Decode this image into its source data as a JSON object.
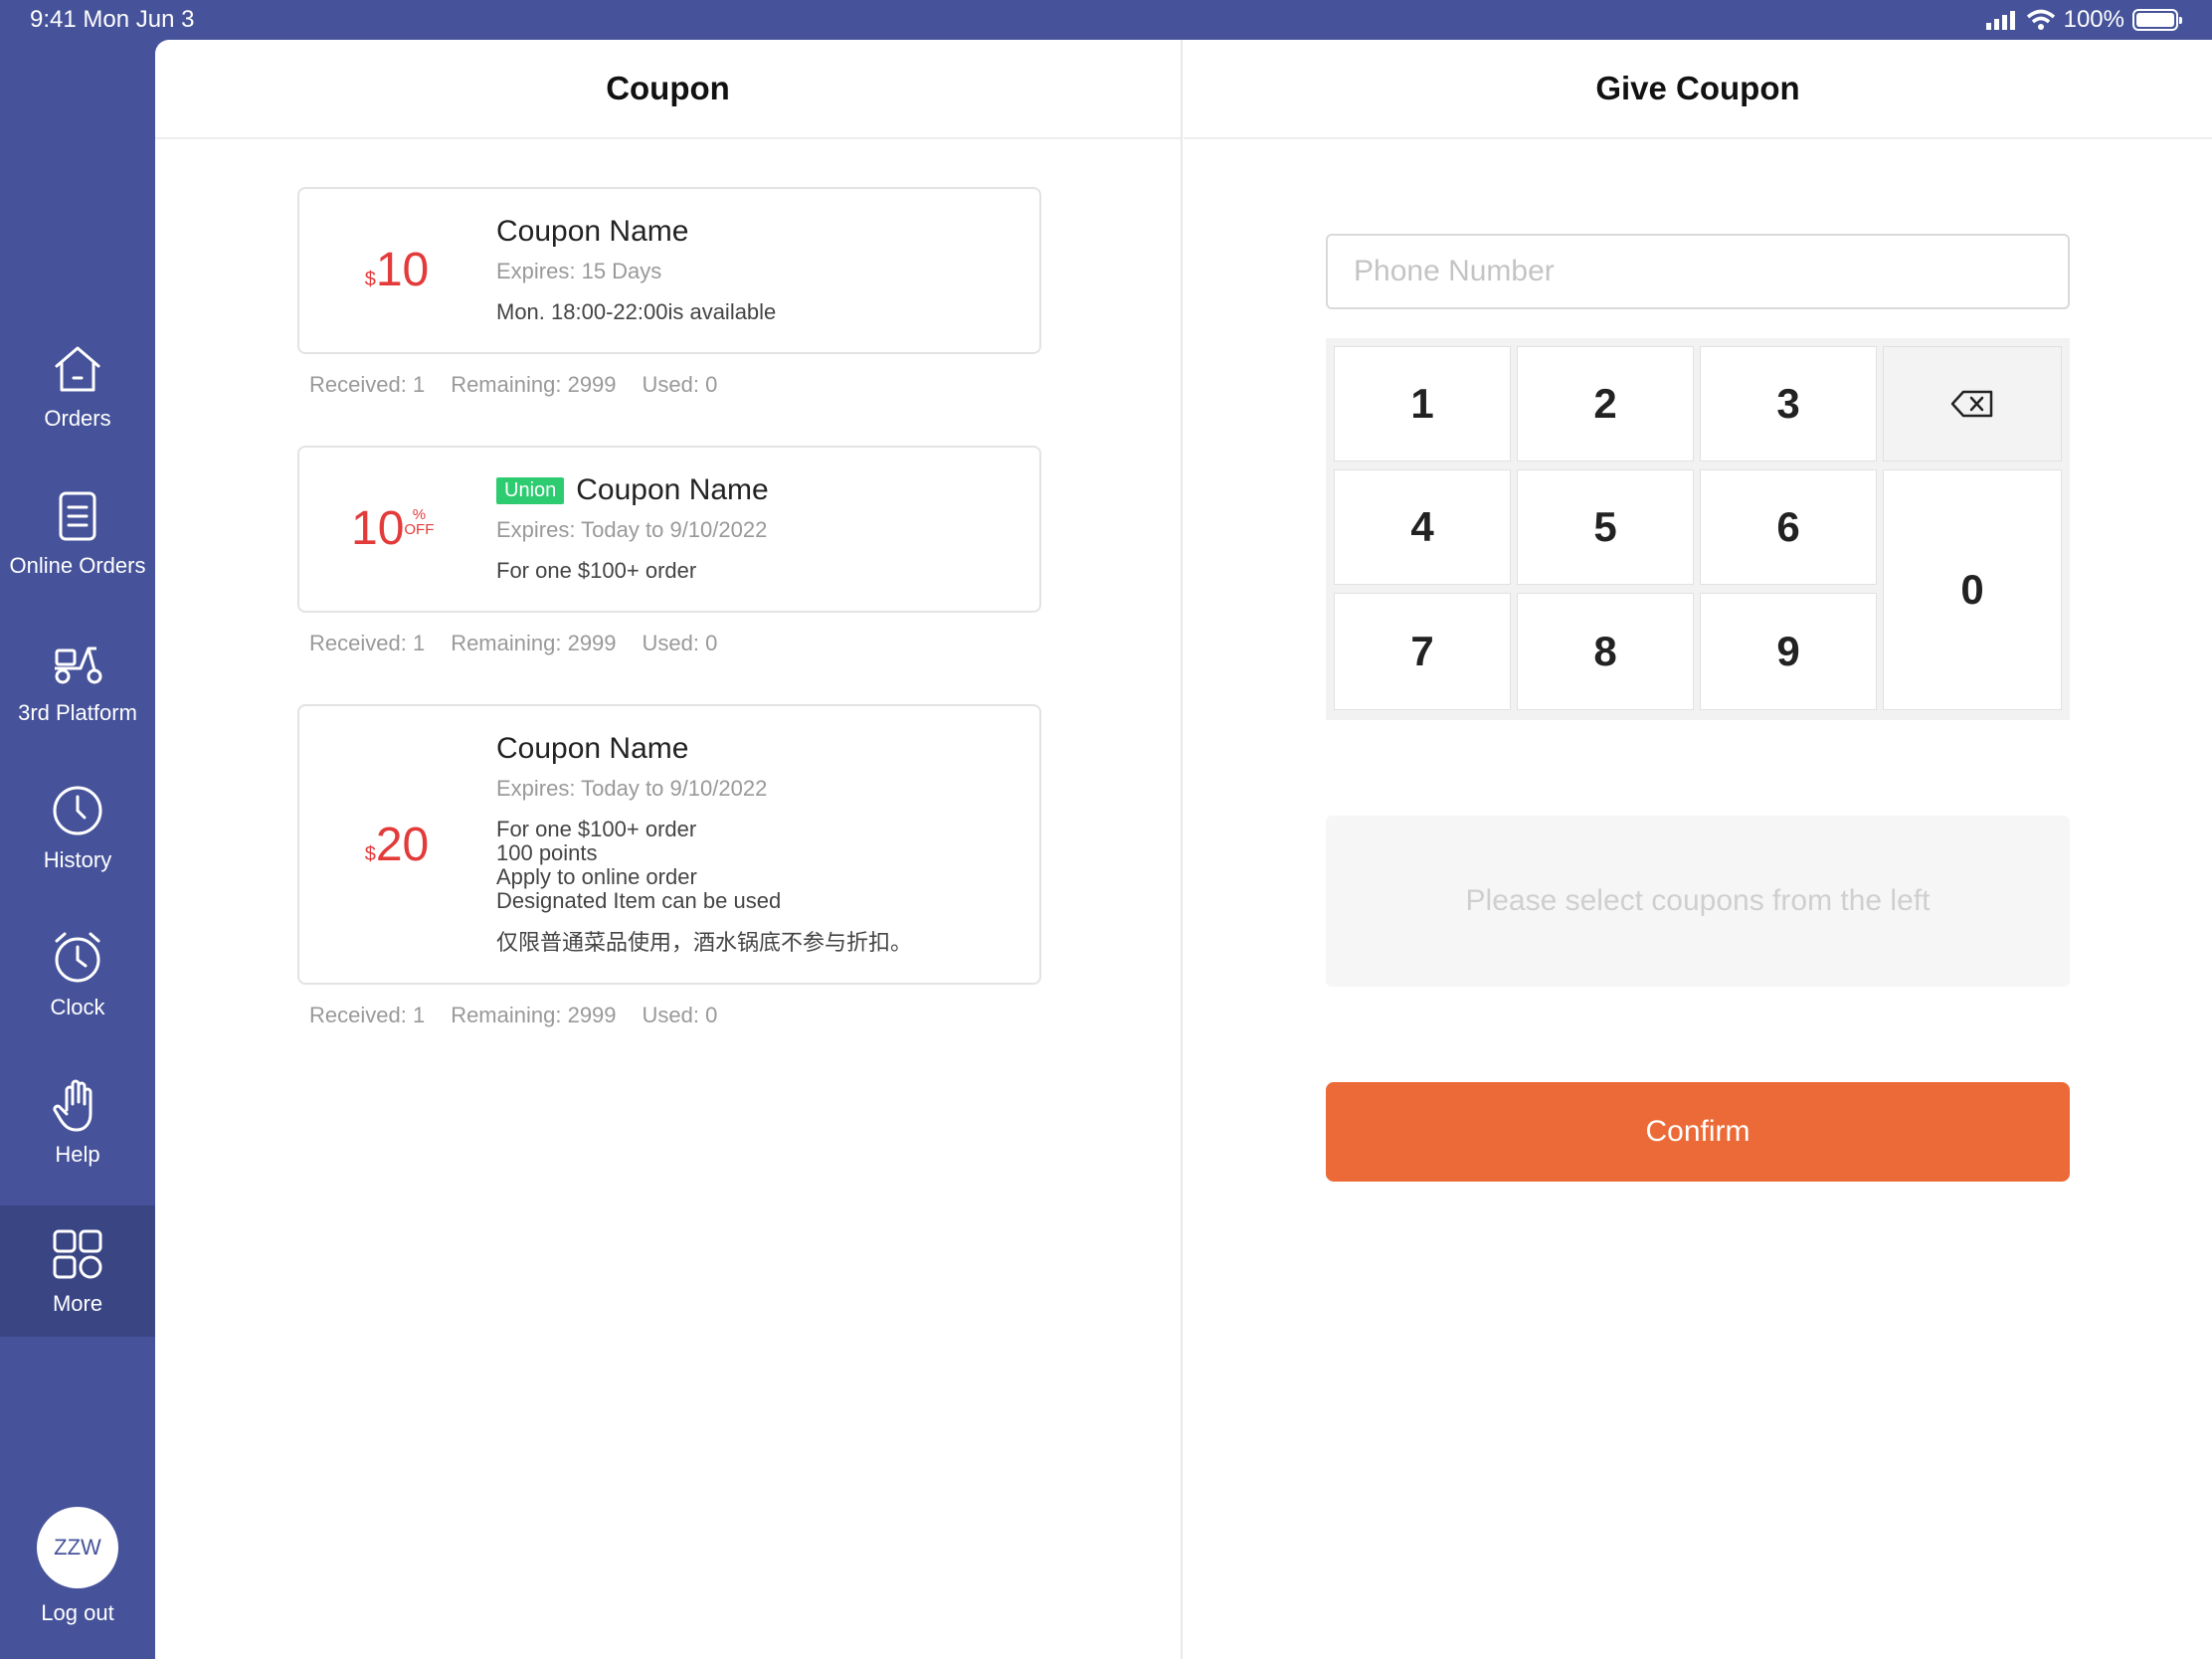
{
  "status_bar": {
    "time": "9:41  Mon Jun 3",
    "battery": "100%"
  },
  "sidebar": {
    "items": [
      {
        "label": "Orders",
        "icon": "home-icon"
      },
      {
        "label": "Online Orders",
        "icon": "document-icon"
      },
      {
        "label": "3rd Platform",
        "icon": "scooter-icon"
      },
      {
        "label": "History",
        "icon": "clock-icon"
      },
      {
        "label": "Clock",
        "icon": "alarm-clock-icon"
      },
      {
        "label": "Help",
        "icon": "hand-icon"
      },
      {
        "label": "More",
        "icon": "grid-icon",
        "active": true
      }
    ],
    "avatar": "ZZW",
    "logout": "Log out"
  },
  "left_panel": {
    "title": "Coupon",
    "coupons": [
      {
        "currency": "$",
        "amount": "10",
        "name": "Coupon Name",
        "expires": "Expires: 15 Days",
        "desc": [
          "Mon. 18:00-22:00is available"
        ],
        "received": "Received: 1",
        "remaining": "Remaining: 2999",
        "used": "Used: 0"
      },
      {
        "amount": "10",
        "pct": "%",
        "off": "OFF",
        "tag": "Union",
        "name": "Coupon Name",
        "expires": "Expires: Today to 9/10/2022",
        "desc": [
          "For one $100+ order"
        ],
        "received": "Received: 1",
        "remaining": "Remaining: 2999",
        "used": "Used: 0"
      },
      {
        "currency": "$",
        "amount": "20",
        "name": "Coupon Name",
        "expires": "Expires: Today to 9/10/2022",
        "desc": [
          "For one $100+ order",
          "100 points",
          "Apply to online order",
          "Designated Item can be used"
        ],
        "note": "仅限普通菜品使用，酒水锅底不参与折扣。",
        "received": "Received: 1",
        "remaining": "Remaining: 2999",
        "used": "Used: 0"
      }
    ]
  },
  "right_panel": {
    "title": "Give Coupon",
    "phone_placeholder": "Phone Number",
    "keys": [
      "1",
      "2",
      "3",
      "4",
      "5",
      "6",
      "7",
      "8",
      "9",
      "0"
    ],
    "hint": "Please select coupons from the left",
    "confirm": "Confirm"
  },
  "colors": {
    "sidebar": "#46539a",
    "accent": "#ec6a37",
    "price": "#e33a3a",
    "tag": "#2ecc71"
  }
}
